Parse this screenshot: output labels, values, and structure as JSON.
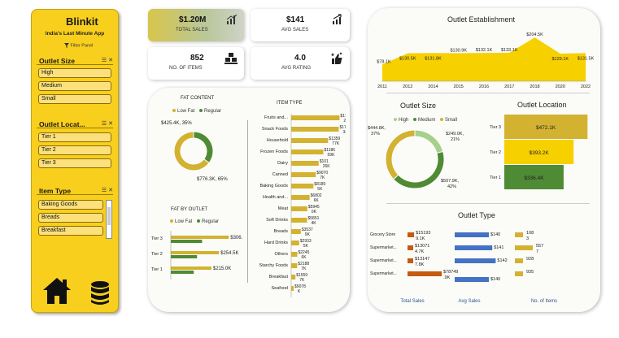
{
  "sidebar": {
    "brand": "Blinkit",
    "tagline": "India's Last Minute App",
    "filter_panel": "Filter Panel",
    "outlet_size": {
      "title": "Outlet Size",
      "items": [
        "High",
        "Medium",
        "Small"
      ]
    },
    "outlet_location": {
      "title": "Outlet Locat...",
      "items": [
        "Tier 1",
        "Tier 2",
        "Tier 3"
      ]
    },
    "item_type": {
      "title": "Item Type",
      "items": [
        "Baking Goods",
        "Breads",
        "Breakfast"
      ]
    },
    "icons": [
      "home-icon",
      "database-icon",
      "multi-select-icon",
      "clear-filter-icon"
    ]
  },
  "kpis": {
    "total_sales": {
      "value": "$1.20M",
      "label": "TOTAL SALES",
      "icon": "bar-chart-icon"
    },
    "avg_sales": {
      "value": "$141",
      "label": "AVG SALES",
      "icon": "growth-chart-icon"
    },
    "items": {
      "value": "852",
      "label": "NO. OF ITEMS",
      "icon": "boxes-icon"
    },
    "rating": {
      "value": "4.0",
      "label": "AVG RATING",
      "icon": "thumbs-up-star-icon"
    }
  },
  "colors": {
    "gold": "#d2b230",
    "green": "#4f8a34",
    "yellow": "#f7d000",
    "blue": "#4472c4",
    "orange": "#c55a11",
    "lightgreen": "#a8d08d"
  },
  "chart_data": [
    {
      "type": "pie",
      "title": "FAT CONTENT",
      "legend": [
        "Low Fat",
        "Regular"
      ],
      "values": [
        776.3,
        425.4
      ],
      "labels": [
        "$776.3K, 65%",
        "$425.4K, 35%"
      ]
    },
    {
      "type": "bar",
      "title": "FAT BY OUTLET",
      "legend": [
        "Low Fat",
        "Regular"
      ],
      "categories": [
        "Tier 3",
        "Tier 2",
        "Tier 1"
      ],
      "series": [
        {
          "name": "Low Fat",
          "values": [
            306.8,
            254.5,
            215.0
          ]
        },
        {
          "name": "Regular",
          "values": [
            165.3,
            138.7,
            121.4
          ]
        }
      ],
      "labels": [
        "$306.8K",
        "$254.5K",
        "$215.0K"
      ]
    },
    {
      "type": "bar",
      "title": "ITEM TYPE",
      "categories": [
        "Fruits and...",
        "Snack Foods",
        "Household",
        "Frozen Foods",
        "Dairy",
        "Canned",
        "Baking Goods",
        "Health and...",
        "Meat",
        "Soft Drinks",
        "Breads",
        "Hard Drinks",
        "Others",
        "Starchy Foods",
        "Breakfast",
        "Seafood"
      ],
      "values": [
        178.1,
        175.4,
        135.9,
        118.6,
        101.2,
        90.7,
        81.9,
        68.0,
        59.4,
        58.5,
        35.4,
        29.3,
        22.5,
        21.9,
        15.6,
        9.1
      ],
      "labels": [
        "$178124K",
        "$175434K",
        "$135977K",
        "$118659K",
        "$10126K",
        "$9070 7K",
        "$8189 5K",
        "$6802 6K",
        "$5945 0K",
        "$5851 4K",
        "$3537 9K",
        "$2933 5K",
        "$2245 6K",
        "$2188 7K",
        "$1559 7K",
        "$9078 K"
      ]
    },
    {
      "type": "area",
      "title": "Outlet Establishment",
      "x": [
        2011,
        2012,
        2014,
        2015,
        2016,
        2017,
        2018,
        2020,
        2022
      ],
      "values": [
        78.1,
        130.5,
        131.8,
        130.9,
        132.1,
        133.1,
        204.5,
        129.1,
        131.5
      ],
      "labels": [
        "$78.1K",
        "$130.5K",
        "$131.8K",
        "$130.9K",
        "$132.1K",
        "$133.1K",
        "$204.5K",
        "$129.1K",
        "$131.5K"
      ]
    },
    {
      "type": "pie",
      "title": "Outlet Size",
      "legend": [
        "High",
        "Medium",
        "Small"
      ],
      "values": [
        249.0,
        507.9,
        444.8
      ],
      "labels": [
        "$249.0K, 21%",
        "$507.9K, 42%",
        "$444.8K, 37%"
      ]
    },
    {
      "type": "bar",
      "title": "Outlet Location",
      "categories": [
        "Tier 3",
        "Tier 2",
        "Tier 1"
      ],
      "values": [
        472.1,
        393.2,
        336.4
      ],
      "labels": [
        "$472.1K",
        "$393.2K",
        "$336.4K"
      ]
    },
    {
      "type": "table",
      "title": "Outlet Type",
      "categories": [
        "Grocery Store",
        "Supermarket...",
        "Supermarket...",
        "Supermarket..."
      ],
      "columns": [
        "Total Sales",
        "Avg Sales",
        "No. of Items"
      ],
      "total_sales": [
        151.9,
        130.7,
        131.4,
        787.5
      ],
      "total_sales_labels": [
        "$151939.1K",
        "$130714.7K",
        "$131477.8K",
        "$78749.9K"
      ],
      "avg_sales": [
        140,
        141,
        142,
        140
      ],
      "avg_sales_labels": [
        "$140",
        "$141",
        "$142",
        "$140"
      ],
      "items": [
        1083,
        5577,
        928,
        935
      ],
      "items_labels": [
        "108 3",
        "557 7",
        "928",
        "935"
      ]
    }
  ]
}
